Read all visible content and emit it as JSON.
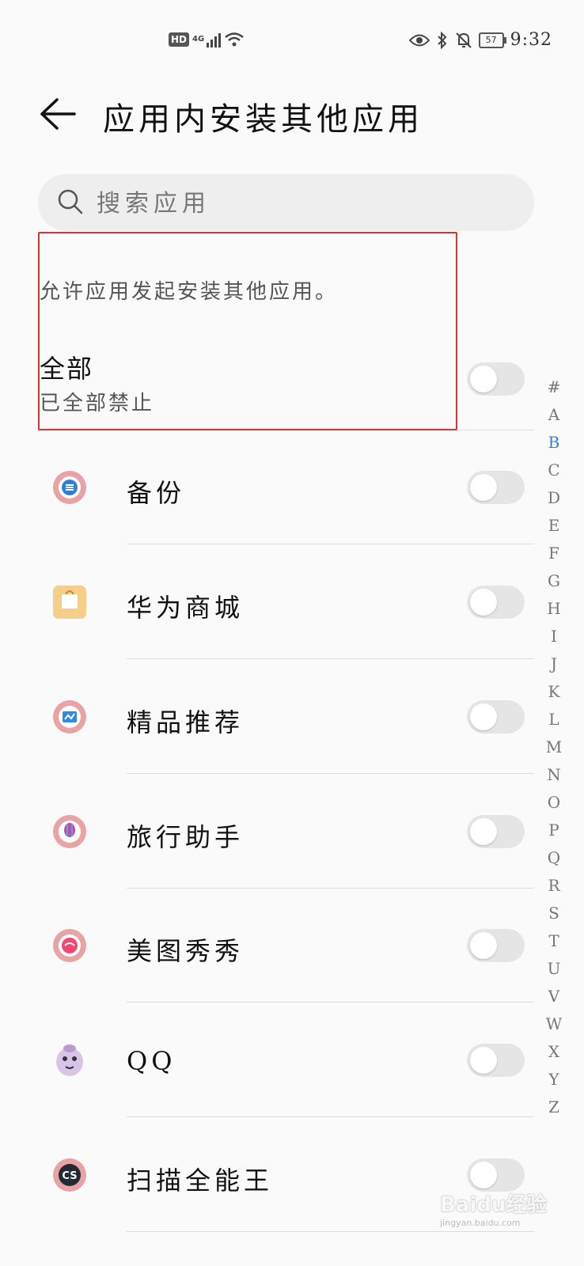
{
  "status_bar": {
    "hd": "HD",
    "network": "4G",
    "battery": "57",
    "time": "9:32"
  },
  "header": {
    "title": "应用内安装其他应用"
  },
  "search": {
    "placeholder": "搜索应用"
  },
  "description": "允许应用发起安装其他应用。",
  "all_row": {
    "title": "全部",
    "subtitle": "已全部禁止",
    "enabled": false
  },
  "apps": [
    {
      "label": "备份",
      "icon": "backup-icon",
      "enabled": false
    },
    {
      "label": "华为商城",
      "icon": "huawei-mall-icon",
      "enabled": false
    },
    {
      "label": "精品推荐",
      "icon": "recommend-icon",
      "enabled": false
    },
    {
      "label": "旅行助手",
      "icon": "travel-icon",
      "enabled": false
    },
    {
      "label": "美图秀秀",
      "icon": "meitu-icon",
      "enabled": false
    },
    {
      "label": "QQ",
      "icon": "qq-icon",
      "enabled": false
    },
    {
      "label": "扫描全能王",
      "icon": "camscanner-icon",
      "enabled": false
    }
  ],
  "index_letters": [
    "#",
    "A",
    "B",
    "C",
    "D",
    "E",
    "F",
    "G",
    "H",
    "I",
    "J",
    "K",
    "L",
    "M",
    "N",
    "O",
    "P",
    "Q",
    "R",
    "S",
    "T",
    "U",
    "V",
    "W",
    "X",
    "Y",
    "Z"
  ],
  "index_active": "B",
  "watermark": {
    "main": "Baidu经验",
    "sub": "jingyan.baidu.com"
  }
}
